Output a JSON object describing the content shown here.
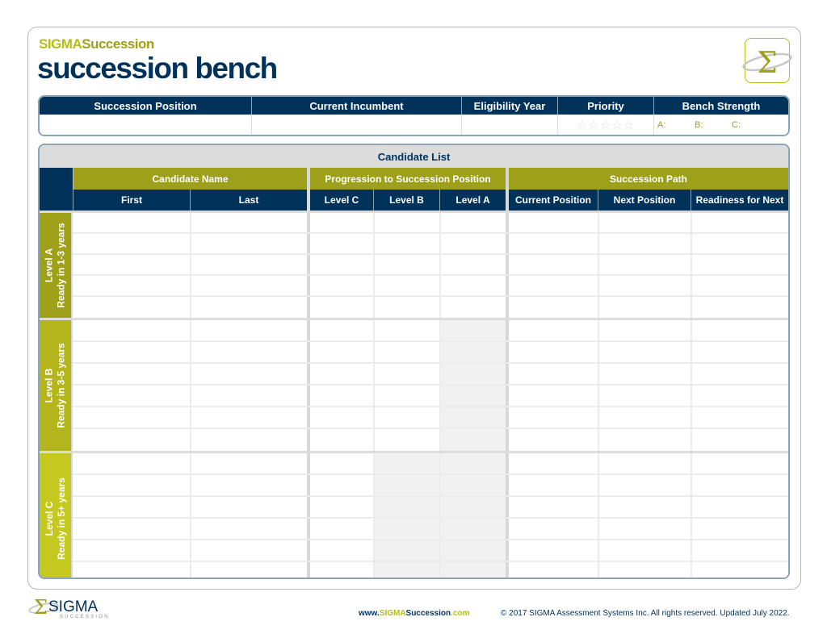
{
  "brand": {
    "sigma": "SIGMA",
    "succession": "Succession"
  },
  "title": "succession bench",
  "logo_icon": "sigma-logo-icon",
  "info": {
    "headers": [
      "Succession Position",
      "Current Incumbent",
      "Eligibility Year",
      "Priority",
      "Bench Strength"
    ],
    "values": {
      "succession_position": "",
      "current_incumbent": "",
      "eligibility_year": ""
    },
    "priority_stars": "☆☆☆☆☆",
    "priority_rating": 0,
    "priority_max": 5,
    "bench": {
      "a": "A:",
      "b": "B:",
      "c": "C:"
    }
  },
  "candidate_list": {
    "title": "Candidate List",
    "groups": [
      "Candidate Name",
      "Progression to Succession Position",
      "Succession Path"
    ],
    "columns": [
      "First",
      "Last",
      "Level C",
      "Level B",
      "Level A",
      "Current Position",
      "Next Position",
      "Readiness for Next"
    ],
    "sections": [
      {
        "level": "Level A",
        "desc": "Ready in 1-3 years",
        "rows": 5
      },
      {
        "level": "Level B",
        "desc": "Ready in 3-5 years",
        "rows": 6
      },
      {
        "level": "Level C",
        "desc": "Ready in 5+ years",
        "rows": 6
      }
    ]
  },
  "footer": {
    "logo_text": "SIGMA",
    "logo_sub": "SUCCESSION",
    "url_prefix": "www.",
    "url_sigma": "SIGMA",
    "url_rest": "Succession",
    "url_suffix": ".com",
    "copyright": "© 2017 SIGMA Assessment Systems Inc. All rights reserved. Updated July 2022."
  },
  "colors": {
    "navy": "#00325a",
    "olive": "#9ea01a",
    "lime": "#b5bd1a"
  }
}
